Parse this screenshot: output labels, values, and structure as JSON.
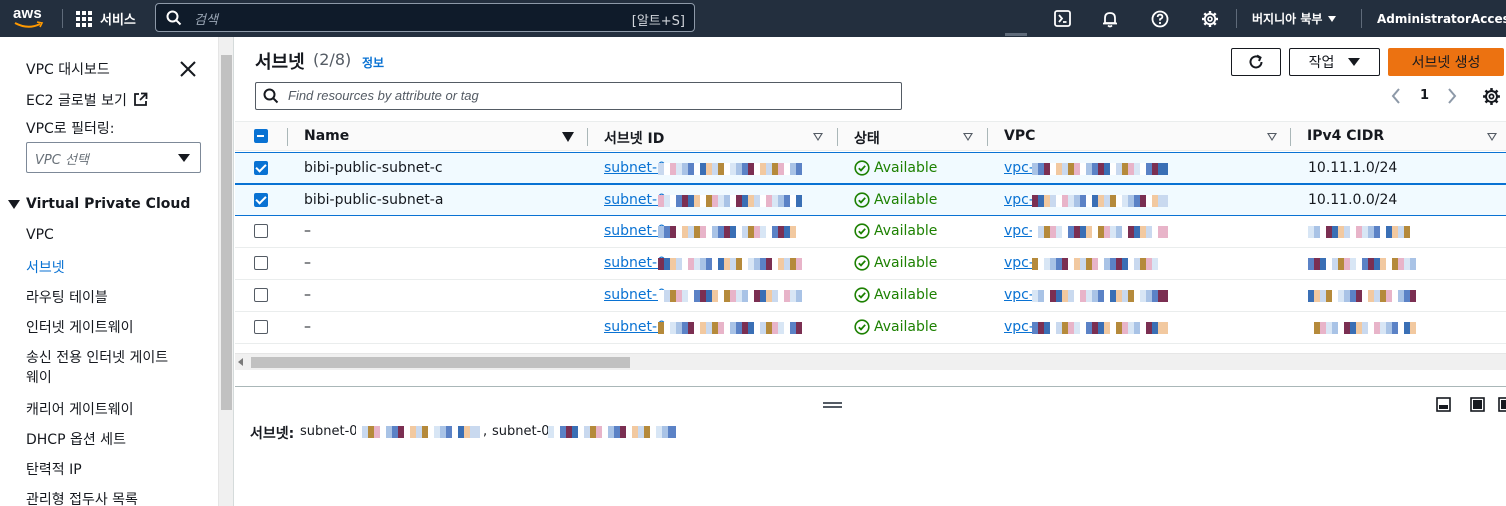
{
  "topnav": {
    "logo": "aws",
    "services_label": "서비스",
    "search_placeholder": "검색",
    "search_shortcut": "[알트+S]",
    "region_label": "버지니아 북부",
    "account_label": "AdministratorAccess",
    "icons": [
      "cloudshell-icon",
      "bell-icon",
      "help-icon",
      "gear-icon"
    ]
  },
  "sidebar": {
    "top_links": [
      "VPC 대시보드",
      "EC2 글로벌 보기"
    ],
    "filter_label": "VPC로 필터링:",
    "filter_placeholder": "VPC 선택",
    "section_title": "Virtual Private Cloud",
    "items": [
      {
        "label": "VPC",
        "active": false
      },
      {
        "label": "서브넷",
        "active": true
      },
      {
        "label": "라우팅 테이블",
        "active": false
      },
      {
        "label": "인터넷 게이트웨이",
        "active": false
      },
      {
        "label": "송신 전용 인터넷 게이트",
        "label2": "웨이",
        "active": false
      },
      {
        "label": "캐리어 게이트웨이",
        "active": false
      },
      {
        "label": "DHCP 옵션 세트",
        "active": false
      },
      {
        "label": "탄력적 IP",
        "active": false
      },
      {
        "label": "관리형 접두사 목록",
        "active": false
      }
    ]
  },
  "main": {
    "title": "서브넷",
    "count": "(2/8)",
    "info_link": "정보",
    "actions_label": "작업",
    "create_label": "서브넷 생성",
    "filter_placeholder": "Find resources by attribute or tag",
    "page_number": "1"
  },
  "table": {
    "columns": [
      "Name",
      "서브넷 ID",
      "상태",
      "VPC",
      "IPv4 CIDR"
    ],
    "rows": [
      {
        "checked": true,
        "name": "bibi-public-subnet-c",
        "subnet_id": "subnet-0",
        "state": "Available",
        "vpc": "vpc-",
        "cidr": "10.11.1.0/24"
      },
      {
        "checked": true,
        "name": "bibi-public-subnet-a",
        "subnet_id": "subnet-0",
        "state": "Available",
        "vpc": "vpc-",
        "cidr": "10.11.0.0/24"
      },
      {
        "checked": false,
        "name": "–",
        "subnet_id": "subnet-0",
        "state": "Available",
        "vpc": "vpc-",
        "cidr": ""
      },
      {
        "checked": false,
        "name": "–",
        "subnet_id": "subnet-0",
        "state": "Available",
        "vpc": "vpc-",
        "cidr": ""
      },
      {
        "checked": false,
        "name": "–",
        "subnet_id": "subnet-0",
        "state": "Available",
        "vpc": "vpc-",
        "cidr": ""
      },
      {
        "checked": false,
        "name": "–",
        "subnet_id": "subnet-0",
        "state": "Available",
        "vpc": "vpc-",
        "cidr": ""
      }
    ]
  },
  "detail": {
    "label": "서브넷:",
    "subnet_a": "subnet-0",
    "separator": ",",
    "subnet_b": "subnet-0"
  },
  "colors": {
    "nav_bg": "#232f3e",
    "link": "#0972d3",
    "primary_button": "#ec7211",
    "available": "#1d8102"
  }
}
